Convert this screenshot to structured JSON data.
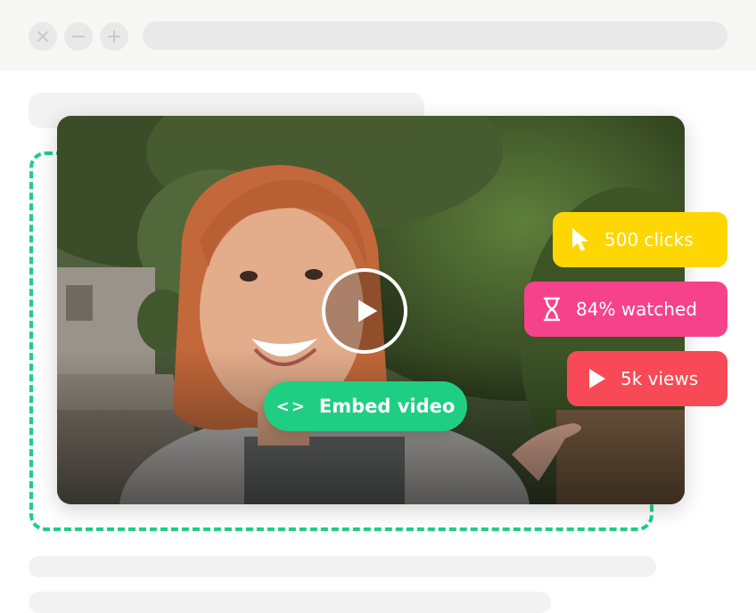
{
  "browser": {
    "buttons": [
      {
        "icon": "close-icon"
      },
      {
        "icon": "minimize-icon"
      },
      {
        "icon": "maximize-icon"
      }
    ]
  },
  "video": {
    "play_icon": "play-icon",
    "embed_button": {
      "icon": "code-icon",
      "icon_text": "<>",
      "label": "Embed video"
    }
  },
  "stats": [
    {
      "label": "500 clicks",
      "icon": "cursor-icon",
      "color": "#ffd600"
    },
    {
      "label": "84% watched",
      "icon": "hourglass-icon",
      "color": "#f6428a"
    },
    {
      "label": "5k views",
      "icon": "play-icon",
      "color": "#f74a56"
    }
  ],
  "colors": {
    "accent": "#1fce83",
    "chrome": "#f7f7f5",
    "skeleton": "#f2f2f2"
  }
}
